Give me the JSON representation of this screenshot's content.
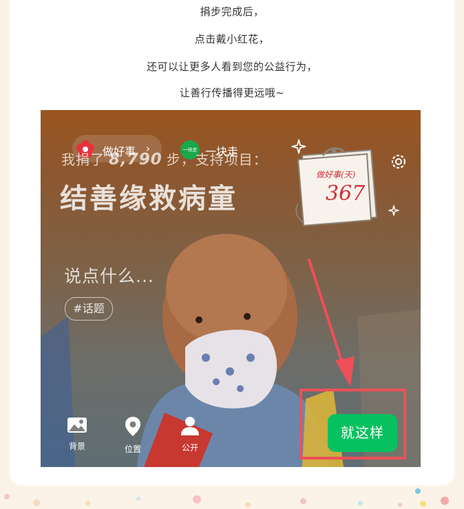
{
  "intro": {
    "lines": [
      "捐步完成后，",
      "点击戴小红花，",
      "还可以让更多人看到您的公益行为，",
      "让善行传播得更远哦~"
    ]
  },
  "top_bar": {
    "good_deed_label": "做好事",
    "yikuaizou_badge": "一块走",
    "yikuaizou_label": "一块走"
  },
  "donation": {
    "steps_prefix": "我捐了",
    "steps_value": "8,790",
    "steps_suffix": "步，支持项目：",
    "project_title": "结善缘救病童"
  },
  "calendar": {
    "label": "做好事(天)",
    "count": "367"
  },
  "composer": {
    "placeholder": "说点什么...",
    "topic_chip": "#话题"
  },
  "toolbar": {
    "background_label": "背景",
    "location_label": "位置",
    "public_label": "公开"
  },
  "confirm_button_label": "就这样",
  "colors": {
    "accent_green": "#07c160",
    "highlight_red": "#ee4f58",
    "calendar_red": "#d0303a"
  }
}
